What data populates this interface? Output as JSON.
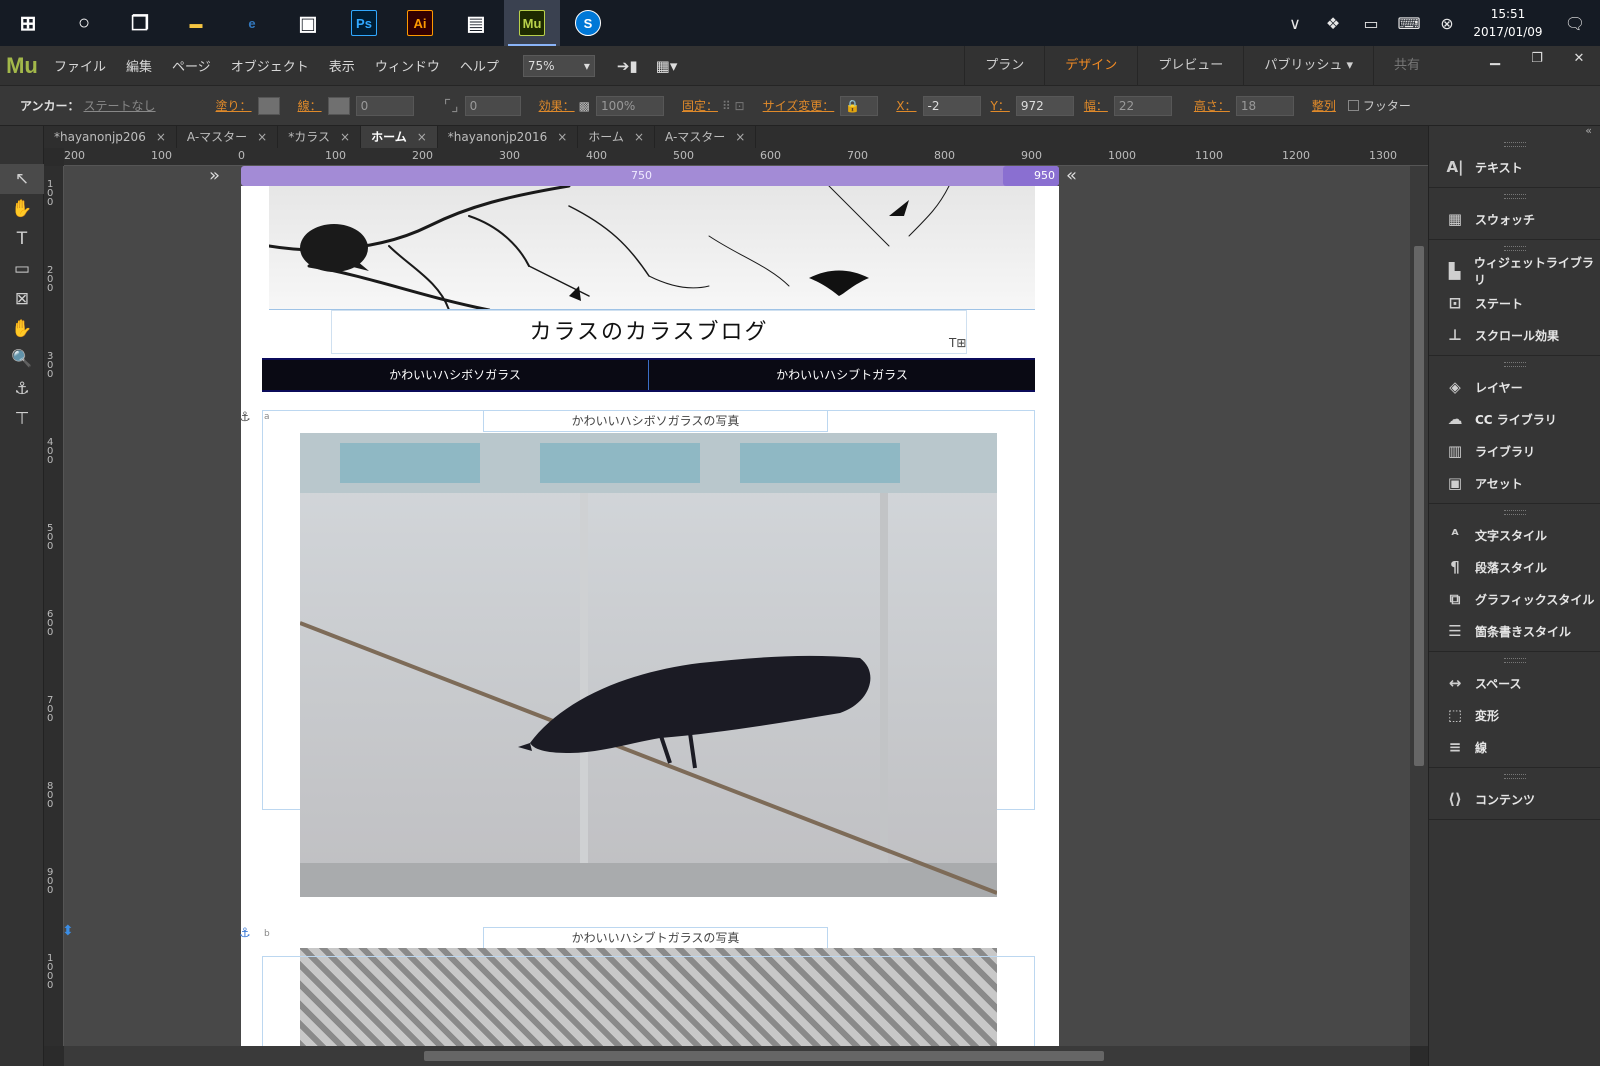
{
  "taskbar": {
    "apps": [
      {
        "name": "windows-start",
        "glyph": "⊞"
      },
      {
        "name": "cortana",
        "glyph": "○"
      },
      {
        "name": "task-view",
        "glyph": "❐"
      },
      {
        "name": "file-explorer",
        "glyph": "▬"
      },
      {
        "name": "edge",
        "glyph": "e"
      },
      {
        "name": "store",
        "glyph": "▣"
      },
      {
        "name": "photoshop",
        "glyph": "Ps"
      },
      {
        "name": "illustrator",
        "glyph": "Ai"
      },
      {
        "name": "network",
        "glyph": "▤"
      },
      {
        "name": "muse",
        "glyph": "Mu"
      },
      {
        "name": "skype",
        "glyph": "S"
      }
    ],
    "time": "15:51",
    "date": "2017/01/09"
  },
  "menubar": {
    "logo": "Mu",
    "items": [
      "ファイル",
      "編集",
      "ページ",
      "オブジェクト",
      "表示",
      "ウィンドウ",
      "ヘルプ"
    ],
    "zoom": "75%",
    "modes": [
      {
        "label": "プラン",
        "state": "normal"
      },
      {
        "label": "デザイン",
        "state": "active"
      },
      {
        "label": "プレビュー",
        "state": "normal"
      },
      {
        "label": "パブリッシュ ▾",
        "state": "normal"
      },
      {
        "label": "共有",
        "state": "dim"
      }
    ]
  },
  "controls": {
    "anchor_label": "アンカー：",
    "state_value": "ステートなし",
    "fill_label": "塗り：",
    "stroke_label": "線：",
    "stroke_value": "0",
    "corner_value": "0",
    "effect_label": "効果：",
    "opacity_value": "100%",
    "pin_label": "固定：",
    "resize_label": "サイズ変更：",
    "x_label": "X：",
    "x_value": "-2",
    "y_label": "Y：",
    "y_value": "972",
    "w_label": "幅：",
    "w_value": "22",
    "h_label": "高さ：",
    "h_value": "18",
    "align_label": "整列",
    "footer_label": "フッター"
  },
  "tabs": [
    {
      "label": "*hayanonjp206",
      "active": false
    },
    {
      "label": "A-マスター",
      "active": false
    },
    {
      "label": "*カラス",
      "active": false
    },
    {
      "label": "ホーム",
      "active": true
    },
    {
      "label": "*hayanonjp2016",
      "active": false
    },
    {
      "label": "ホーム",
      "active": false
    },
    {
      "label": "A-マスター",
      "active": false
    }
  ],
  "tools": [
    "select-arrow-icon",
    "crop-hand-icon",
    "text-tool-icon",
    "rectangle-tool-icon",
    "image-frame-icon",
    "hand-tool-icon",
    "zoom-tool-icon",
    "anchor-tool-icon",
    "text-frame-icon"
  ],
  "tool_glyphs": [
    "↖",
    "✋",
    "T",
    "▭",
    "⊠",
    "✋",
    "🔍",
    "⚓",
    "⊤"
  ],
  "hruler": [
    "200",
    "100",
    "0",
    "100",
    "200",
    "300",
    "400",
    "500",
    "600",
    "700",
    "800",
    "900",
    "1000",
    "1100",
    "1200",
    "1300"
  ],
  "vruler": [
    "100",
    "200",
    "300",
    "400",
    "500",
    "600",
    "700",
    "800",
    "900",
    "1000"
  ],
  "breakpoint": {
    "width_label": "750",
    "end_label": "950"
  },
  "page": {
    "site_title": "カラスのカラスブログ",
    "nav": [
      "かわいいハシボソガラス",
      "かわいいハシブトガラス"
    ],
    "caption1": "かわいいハシボソガラスの写真",
    "caption2": "かわいいハシブトガラスの写真",
    "anchor_a": "a",
    "anchor_b": "b"
  },
  "rpanel": {
    "groups": [
      [
        {
          "label": "テキスト",
          "icon": "A|"
        }
      ],
      [
        {
          "label": "スウォッチ",
          "icon": "▦"
        }
      ],
      [
        {
          "label": "ウィジェットライブラリ",
          "icon": "▙"
        },
        {
          "label": "ステート",
          "icon": "⊡"
        },
        {
          "label": "スクロール効果",
          "icon": "⊥"
        }
      ],
      [
        {
          "label": "レイヤー",
          "icon": "◈"
        },
        {
          "label": "CC ライブラリ",
          "icon": "☁"
        },
        {
          "label": "ライブラリ",
          "icon": "▥"
        },
        {
          "label": "アセット",
          "icon": "▣"
        }
      ],
      [
        {
          "label": "文字スタイル",
          "icon": "ᴬ"
        },
        {
          "label": "段落スタイル",
          "icon": "¶"
        },
        {
          "label": "グラフィックスタイル",
          "icon": "⧉"
        },
        {
          "label": "箇条書きスタイル",
          "icon": "☰"
        }
      ],
      [
        {
          "label": "スペース",
          "icon": "↔"
        },
        {
          "label": "変形",
          "icon": "⬚"
        },
        {
          "label": "線",
          "icon": "≡"
        }
      ],
      [
        {
          "label": "コンテンツ",
          "icon": "⟨⟩"
        }
      ]
    ]
  }
}
